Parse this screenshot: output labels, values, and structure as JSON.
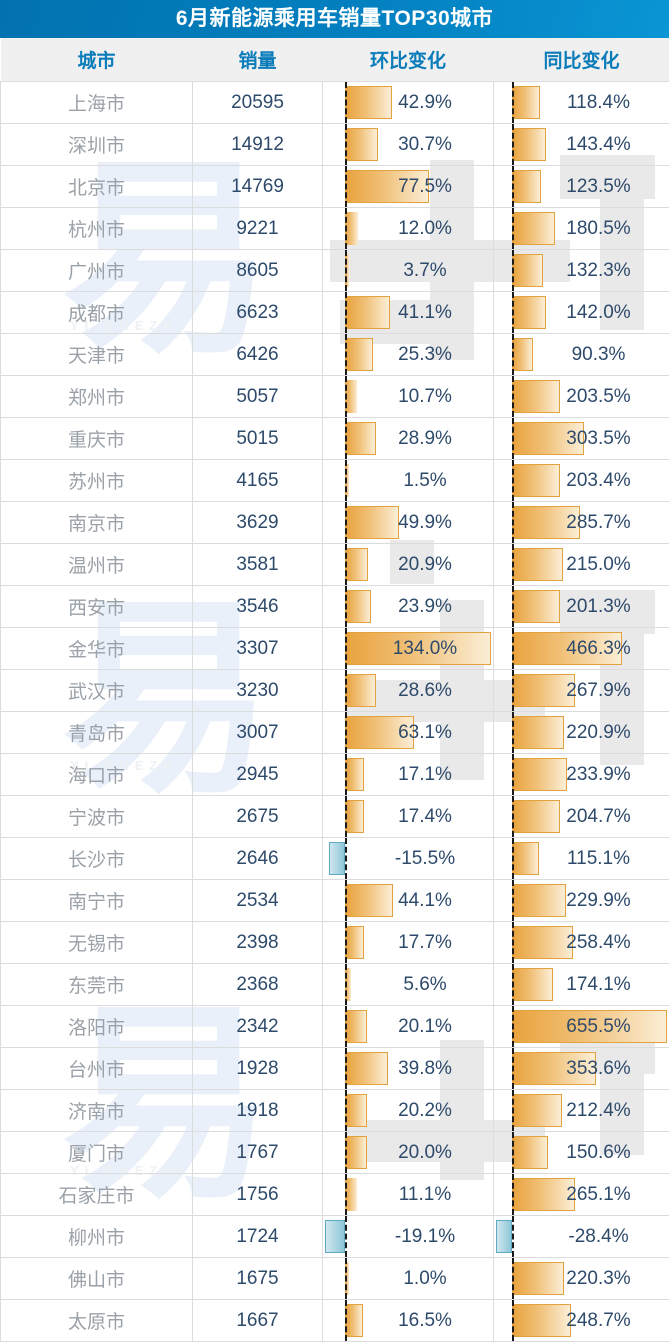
{
  "title": "6月新能源乘用车销量TOP30城市",
  "watermark": {
    "logo": "易",
    "sub": "YI CHEZHI"
  },
  "colors": {
    "title_bar_start": "#0272af",
    "title_bar_end": "#0a95d4",
    "header_bg": "#f0f0f0",
    "header_text": "#0b7cba",
    "positive_bar": "#e9a33e",
    "negative_bar": "#8ec6d8",
    "value_text": "#2e4a6b",
    "city_text": "#9aa1a8",
    "grid_line": "#dcdcdc"
  },
  "header": {
    "city": "城市",
    "sales": "销量",
    "mom": "环比变化",
    "yoy": "同比变化"
  },
  "chart_data": {
    "type": "table",
    "title": "6月新能源乘用车销量TOP30城市",
    "columns": [
      "城市",
      "销量",
      "环比变化",
      "同比变化"
    ],
    "mom_max": 134.0,
    "mom_min": -19.1,
    "yoy_max": 655.5,
    "yoy_min": -28.4,
    "rows": [
      {
        "city": "上海市",
        "sales": "20595",
        "mom": "42.9%",
        "yoy": "118.4%",
        "mom_v": 42.9,
        "yoy_v": 118.4
      },
      {
        "city": "深圳市",
        "sales": "14912",
        "mom": "30.7%",
        "yoy": "143.4%",
        "mom_v": 30.7,
        "yoy_v": 143.4
      },
      {
        "city": "北京市",
        "sales": "14769",
        "mom": "77.5%",
        "yoy": "123.5%",
        "mom_v": 77.5,
        "yoy_v": 123.5
      },
      {
        "city": "杭州市",
        "sales": "9221",
        "mom": "12.0%",
        "yoy": "180.5%",
        "mom_v": 12.0,
        "yoy_v": 180.5
      },
      {
        "city": "广州市",
        "sales": "8605",
        "mom": "3.7%",
        "yoy": "132.3%",
        "mom_v": 3.7,
        "yoy_v": 132.3
      },
      {
        "city": "成都市",
        "sales": "6623",
        "mom": "41.1%",
        "yoy": "142.0%",
        "mom_v": 41.1,
        "yoy_v": 142.0
      },
      {
        "city": "天津市",
        "sales": "6426",
        "mom": "25.3%",
        "yoy": "90.3%",
        "mom_v": 25.3,
        "yoy_v": 90.3
      },
      {
        "city": "郑州市",
        "sales": "5057",
        "mom": "10.7%",
        "yoy": "203.5%",
        "mom_v": 10.7,
        "yoy_v": 203.5
      },
      {
        "city": "重庆市",
        "sales": "5015",
        "mom": "28.9%",
        "yoy": "303.5%",
        "mom_v": 28.9,
        "yoy_v": 303.5
      },
      {
        "city": "苏州市",
        "sales": "4165",
        "mom": "1.5%",
        "yoy": "203.4%",
        "mom_v": 1.5,
        "yoy_v": 203.4
      },
      {
        "city": "南京市",
        "sales": "3629",
        "mom": "49.9%",
        "yoy": "285.7%",
        "mom_v": 49.9,
        "yoy_v": 285.7
      },
      {
        "city": "温州市",
        "sales": "3581",
        "mom": "20.9%",
        "yoy": "215.0%",
        "mom_v": 20.9,
        "yoy_v": 215.0
      },
      {
        "city": "西安市",
        "sales": "3546",
        "mom": "23.9%",
        "yoy": "201.3%",
        "mom_v": 23.9,
        "yoy_v": 201.3
      },
      {
        "city": "金华市",
        "sales": "3307",
        "mom": "134.0%",
        "yoy": "466.3%",
        "mom_v": 134.0,
        "yoy_v": 466.3
      },
      {
        "city": "武汉市",
        "sales": "3230",
        "mom": "28.6%",
        "yoy": "267.9%",
        "mom_v": 28.6,
        "yoy_v": 267.9
      },
      {
        "city": "青岛市",
        "sales": "3007",
        "mom": "63.1%",
        "yoy": "220.9%",
        "mom_v": 63.1,
        "yoy_v": 220.9
      },
      {
        "city": "海口市",
        "sales": "2945",
        "mom": "17.1%",
        "yoy": "233.9%",
        "mom_v": 17.1,
        "yoy_v": 233.9
      },
      {
        "city": "宁波市",
        "sales": "2675",
        "mom": "17.4%",
        "yoy": "204.7%",
        "mom_v": 17.4,
        "yoy_v": 204.7
      },
      {
        "city": "长沙市",
        "sales": "2646",
        "mom": "-15.5%",
        "yoy": "115.1%",
        "mom_v": -15.5,
        "yoy_v": 115.1
      },
      {
        "city": "南宁市",
        "sales": "2534",
        "mom": "44.1%",
        "yoy": "229.9%",
        "mom_v": 44.1,
        "yoy_v": 229.9
      },
      {
        "city": "无锡市",
        "sales": "2398",
        "mom": "17.7%",
        "yoy": "258.4%",
        "mom_v": 17.7,
        "yoy_v": 258.4
      },
      {
        "city": "东莞市",
        "sales": "2368",
        "mom": "5.6%",
        "yoy": "174.1%",
        "mom_v": 5.6,
        "yoy_v": 174.1
      },
      {
        "city": "洛阳市",
        "sales": "2342",
        "mom": "20.1%",
        "yoy": "655.5%",
        "mom_v": 20.1,
        "yoy_v": 655.5
      },
      {
        "city": "台州市",
        "sales": "1928",
        "mom": "39.8%",
        "yoy": "353.6%",
        "mom_v": 39.8,
        "yoy_v": 353.6
      },
      {
        "city": "济南市",
        "sales": "1918",
        "mom": "20.2%",
        "yoy": "212.4%",
        "mom_v": 20.2,
        "yoy_v": 212.4
      },
      {
        "city": "厦门市",
        "sales": "1767",
        "mom": "20.0%",
        "yoy": "150.6%",
        "mom_v": 20.0,
        "yoy_v": 150.6
      },
      {
        "city": "石家庄市",
        "sales": "1756",
        "mom": "11.1%",
        "yoy": "265.1%",
        "mom_v": 11.1,
        "yoy_v": 265.1
      },
      {
        "city": "柳州市",
        "sales": "1724",
        "mom": "-19.1%",
        "yoy": "-28.4%",
        "mom_v": -19.1,
        "yoy_v": -28.4
      },
      {
        "city": "佛山市",
        "sales": "1675",
        "mom": "1.0%",
        "yoy": "220.3%",
        "mom_v": 1.0,
        "yoy_v": 220.3
      },
      {
        "city": "太原市",
        "sales": "1667",
        "mom": "16.5%",
        "yoy": "248.7%",
        "mom_v": 16.5,
        "yoy_v": 248.7
      }
    ]
  }
}
